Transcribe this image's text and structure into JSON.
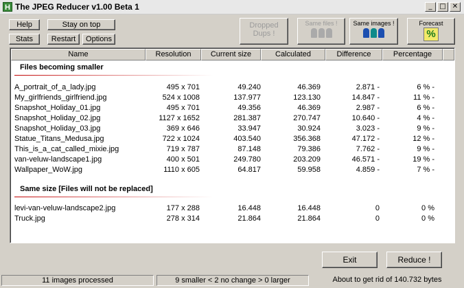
{
  "window": {
    "title": "The JPEG Reducer v1.00 Beta 1",
    "app_icon_letter": "H"
  },
  "toolbar": {
    "help": "Help",
    "stay_on_top": "Stay on top",
    "stats": "Stats",
    "restart": "Restart",
    "options": "Options",
    "dropped_dups_line1": "Dropped",
    "dropped_dups_line2": "Dups !",
    "same_files": "Same files !",
    "same_images": "Same images !",
    "forecast": "Forecast",
    "forecast_symbol": "%"
  },
  "table": {
    "columns": [
      "Name",
      "Resolution",
      "Current size",
      "Calculated",
      "Difference",
      "Percentage"
    ],
    "group_smaller": "Files becoming smaller",
    "rows_smaller": [
      {
        "name": "A_portrait_of_a_lady.jpg",
        "resolution": "495 x 701",
        "current": "49.240",
        "calculated": "46.369",
        "difference": "2.871 -",
        "percentage": "6 % -"
      },
      {
        "name": "My_girlfriends_girlfriend.jpg",
        "resolution": "524 x 1008",
        "current": "137.977",
        "calculated": "123.130",
        "difference": "14.847 -",
        "percentage": "11 % -"
      },
      {
        "name": "Snapshot_Holiday_01.jpg",
        "resolution": "495 x 701",
        "current": "49.356",
        "calculated": "46.369",
        "difference": "2.987 -",
        "percentage": "6 % -"
      },
      {
        "name": "Snapshot_Holiday_02.jpg",
        "resolution": "1127 x 1652",
        "current": "281.387",
        "calculated": "270.747",
        "difference": "10.640 -",
        "percentage": "4 % -"
      },
      {
        "name": "Snapshot_Holiday_03.jpg",
        "resolution": "369 x 646",
        "current": "33.947",
        "calculated": "30.924",
        "difference": "3.023 -",
        "percentage": "9 % -"
      },
      {
        "name": "Statue_Titans_Medusa.jpg",
        "resolution": "722 x 1024",
        "current": "403.540",
        "calculated": "356.368",
        "difference": "47.172 -",
        "percentage": "12 % -"
      },
      {
        "name": "This_is_a_cat_called_mixie.jpg",
        "resolution": "719 x 787",
        "current": "87.148",
        "calculated": "79.386",
        "difference": "7.762 -",
        "percentage": "9 % -"
      },
      {
        "name": "van-veluw-landscape1.jpg",
        "resolution": "400 x 501",
        "current": "249.780",
        "calculated": "203.209",
        "difference": "46.571 -",
        "percentage": "19 % -"
      },
      {
        "name": "Wallpaper_WoW.jpg",
        "resolution": "1110 x 605",
        "current": "64.817",
        "calculated": "59.958",
        "difference": "4.859 -",
        "percentage": "7 % -"
      }
    ],
    "group_same": "Same size  [Files will not be replaced]",
    "rows_same": [
      {
        "name": "levi-van-veluw-landscape2.jpg",
        "resolution": "177 x 288",
        "current": "16.448",
        "calculated": "16.448",
        "difference": "0",
        "percentage": "0 %"
      },
      {
        "name": "Truck.jpg",
        "resolution": "278 x 314",
        "current": "21.864",
        "calculated": "21.864",
        "difference": "0",
        "percentage": "0 %"
      }
    ]
  },
  "actions": {
    "exit": "Exit",
    "reduce": "Reduce !"
  },
  "status": {
    "processed": "11 images processed",
    "summary": "9 smaller < 2 no change > 0 larger",
    "savings": "About to get rid of 140.732 bytes"
  }
}
